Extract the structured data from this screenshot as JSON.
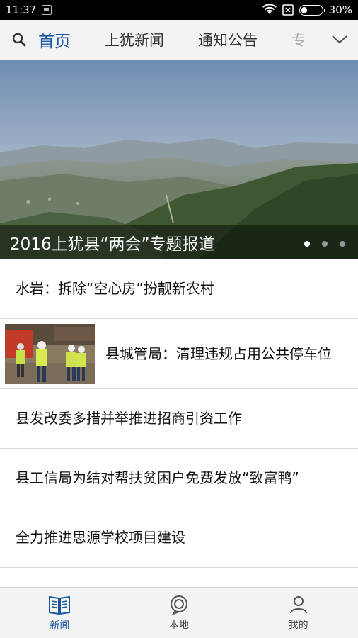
{
  "status_bar": {
    "time": "11:37",
    "battery": "30%",
    "battery_level": 0.3
  },
  "nav": {
    "tabs": [
      {
        "label": "首页",
        "active": true
      },
      {
        "label": "上犹新闻",
        "active": false
      },
      {
        "label": "通知公告",
        "active": false
      },
      {
        "label": "专",
        "active": false
      }
    ],
    "search_icon": "search-icon",
    "more_icon": "chevron-down-icon"
  },
  "banner": {
    "title": "2016上犹县“两会”专题报道",
    "slide_count": 3,
    "active_slide": 1
  },
  "news": [
    {
      "title": "水岩：拆除“空心房”扮靓新农村"
    },
    {
      "title": "县城管局：清理违规占用公共停车位",
      "has_image": true
    },
    {
      "title": "县发改委多措并举推进招商引资工作"
    },
    {
      "title": "县工信局为结对帮扶贫困户免费发放“致富鸭”"
    },
    {
      "title": "全力推进思源学校项目建设"
    }
  ],
  "bottom_tabs": [
    {
      "label": "新闻",
      "icon": "book-icon",
      "active": true
    },
    {
      "label": "本地",
      "icon": "location-icon",
      "active": false
    },
    {
      "label": "我的",
      "icon": "person-icon",
      "active": false
    }
  ],
  "colors": {
    "accent": "#1a56a0"
  }
}
